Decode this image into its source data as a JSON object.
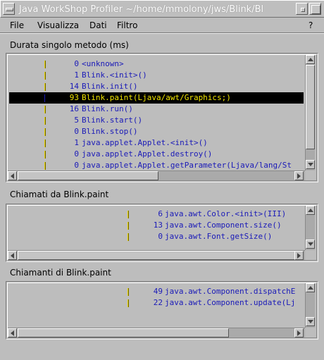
{
  "window": {
    "title": "Java WorkShop Profiler ~/home/mmolony/jws/Blink/Bl"
  },
  "menubar": {
    "items": [
      "File",
      "Visualizza",
      "Dati",
      "Filtro"
    ],
    "help": "?"
  },
  "sections": {
    "methods_label": "Durata singolo metodo (ms)",
    "called_by_label": "Chiamati da Blink.paint",
    "callers_label": "Chiamanti di Blink.paint"
  },
  "methods": [
    {
      "count": "0",
      "name": "<unknown>"
    },
    {
      "count": "1",
      "name": "Blink.<init>()"
    },
    {
      "count": "14",
      "name": "Blink.init()"
    },
    {
      "count": "93",
      "name": "Blink.paint(Ljava/awt/Graphics;)",
      "selected": true
    },
    {
      "count": "16",
      "name": "Blink.run()"
    },
    {
      "count": "5",
      "name": "Blink.start()"
    },
    {
      "count": "0",
      "name": "Blink.stop()"
    },
    {
      "count": "1",
      "name": "java.applet.Applet.<init>()"
    },
    {
      "count": "0",
      "name": "java.applet.Applet.destroy()"
    },
    {
      "count": "0",
      "name": "java.applet.Applet.getParameter(Ljava/lang/St"
    }
  ],
  "called_by": [
    {
      "count": "6",
      "name": "java.awt.Color.<init>(III)"
    },
    {
      "count": "13",
      "name": "java.awt.Component.size()"
    },
    {
      "count": "0",
      "name": "java.awt.Font.getSize()"
    }
  ],
  "callers": [
    {
      "count": "49",
      "name": "java.awt.Component.dispatchE"
    },
    {
      "count": "22",
      "name": "java.awt.Component.update(Lj"
    }
  ],
  "colors": {
    "text_blue": "#1a1ab8",
    "selection_bg": "#000000",
    "selection_text": "#f2e600",
    "bar_yellow": "#e8d300",
    "window_bg": "#bdbdbd"
  },
  "icons": [
    "window-menu-icon",
    "minimize-icon",
    "maximize-icon",
    "scroll-up-icon",
    "scroll-down-icon",
    "scroll-left-icon",
    "scroll-right-icon"
  ]
}
